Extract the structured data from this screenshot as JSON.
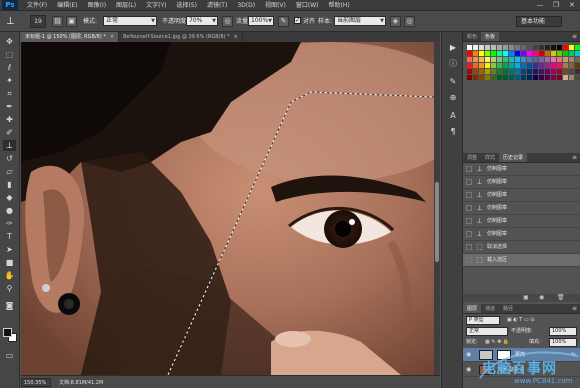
{
  "app": {
    "logo": "Ps"
  },
  "menu": [
    "文件(F)",
    "编辑(E)",
    "图像(I)",
    "图层(L)",
    "文字(Y)",
    "选择(S)",
    "滤镜(T)",
    "3D(D)",
    "视图(V)",
    "窗口(W)",
    "帮助(H)"
  ],
  "window_controls": [
    "—",
    "❐",
    "✕"
  ],
  "options": {
    "brush_size": "19",
    "mode_label": "模式:",
    "mode_value": "正常",
    "opacity_label": "不透明度:",
    "opacity_value": "70%",
    "flow_label": "流量:",
    "flow_value": "100%",
    "aligned_label": "对齐",
    "sample_label": "样本:",
    "sample_value": "当前图层",
    "workspace": "基本功能"
  },
  "doc_tabs": [
    {
      "label": "未标题-1 @ 150% (图层, RGB/8) *",
      "active": true
    },
    {
      "label": "BeYourself-Source1.jpg @ 39.6% (RGB/8) *",
      "active": false
    }
  ],
  "status": {
    "zoom": "150.35%",
    "doc": "文档:8.81M/41.2M"
  },
  "swatch_panel": {
    "tabs": [
      "颜色",
      "色板"
    ],
    "active": 1
  },
  "swatch_colors": [
    "#ffffff",
    "#eeeeee",
    "#dddddd",
    "#cccccc",
    "#bbbbbb",
    "#aaaaaa",
    "#999999",
    "#888888",
    "#777777",
    "#666666",
    "#555555",
    "#444444",
    "#333333",
    "#222222",
    "#111111",
    "#000000",
    "#ff0000",
    "#ffff00",
    "#00ff00",
    "#ff0000",
    "#ff8000",
    "#ffff00",
    "#80ff00",
    "#00ff00",
    "#00ff80",
    "#00ffff",
    "#0080ff",
    "#0000ff",
    "#8000ff",
    "#ff00ff",
    "#ff0080",
    "#cc0000",
    "#cc6600",
    "#cccc00",
    "#66cc00",
    "#00cc00",
    "#00cc66",
    "#00cccc",
    "#f26c4f",
    "#f68e55",
    "#fbaf5c",
    "#fff467",
    "#acd372",
    "#7cc576",
    "#3bb878",
    "#1abbb4",
    "#00bff3",
    "#438cca",
    "#5574b9",
    "#605ca8",
    "#855fa8",
    "#a763a8",
    "#f06ea9",
    "#f26d7d",
    "#c69c6d",
    "#998675",
    "#736357",
    "#ed1c24",
    "#f26522",
    "#f7941d",
    "#fff200",
    "#8dc73f",
    "#39b54a",
    "#00a651",
    "#00a99d",
    "#00aeef",
    "#0072bc",
    "#0054a6",
    "#2e3192",
    "#662d91",
    "#92278f",
    "#ec008c",
    "#ed145b",
    "#a67c52",
    "#8c6239",
    "#603913",
    "#9e0b0f",
    "#a0410d",
    "#a3620a",
    "#aba000",
    "#598527",
    "#197b30",
    "#007236",
    "#00746b",
    "#0076a3",
    "#004a80",
    "#003471",
    "#1b1464",
    "#440e62",
    "#630460",
    "#9e005d",
    "#9e0039",
    "#754c24",
    "#534741",
    "#362f2d",
    "#790000",
    "#7b2e00",
    "#7d4900",
    "#827b00",
    "#406618",
    "#005e20",
    "#005826",
    "#005952",
    "#005b7f",
    "#003663",
    "#002157",
    "#0d004c",
    "#32004b",
    "#4b0049",
    "#7b0046",
    "#7a0026",
    "#c7b299",
    "#998675",
    "#534741"
  ],
  "history_panel": {
    "tabs": [
      "调整",
      "样式",
      "历史记录"
    ],
    "active": 2,
    "items": [
      {
        "label": "仿制图章",
        "selected": false
      },
      {
        "label": "仿制图章",
        "selected": false
      },
      {
        "label": "仿制图章",
        "selected": false
      },
      {
        "label": "仿制图章",
        "selected": false
      },
      {
        "label": "仿制图章",
        "selected": false
      },
      {
        "label": "仿制图章",
        "selected": false
      },
      {
        "label": "取消选择",
        "selected": false
      },
      {
        "label": "载入选区",
        "selected": true
      }
    ]
  },
  "layers_panel": {
    "tabs": [
      "图层",
      "通道",
      "路径"
    ],
    "active": 0,
    "kind_label": "P 类型",
    "blend_mode": "正常",
    "opacity_label": "不透明度:",
    "opacity_value": "100%",
    "lock_label": "锁定:",
    "fill_label": "填充:",
    "fill_value": "100%",
    "layers": [
      {
        "name": "蒙典",
        "fx": "fx",
        "active": true
      },
      {
        "name": "背景 副本 2",
        "fx": "",
        "active": false
      }
    ]
  },
  "watermark": {
    "text": "电脑百事网",
    "url": "www.PC841.com"
  }
}
